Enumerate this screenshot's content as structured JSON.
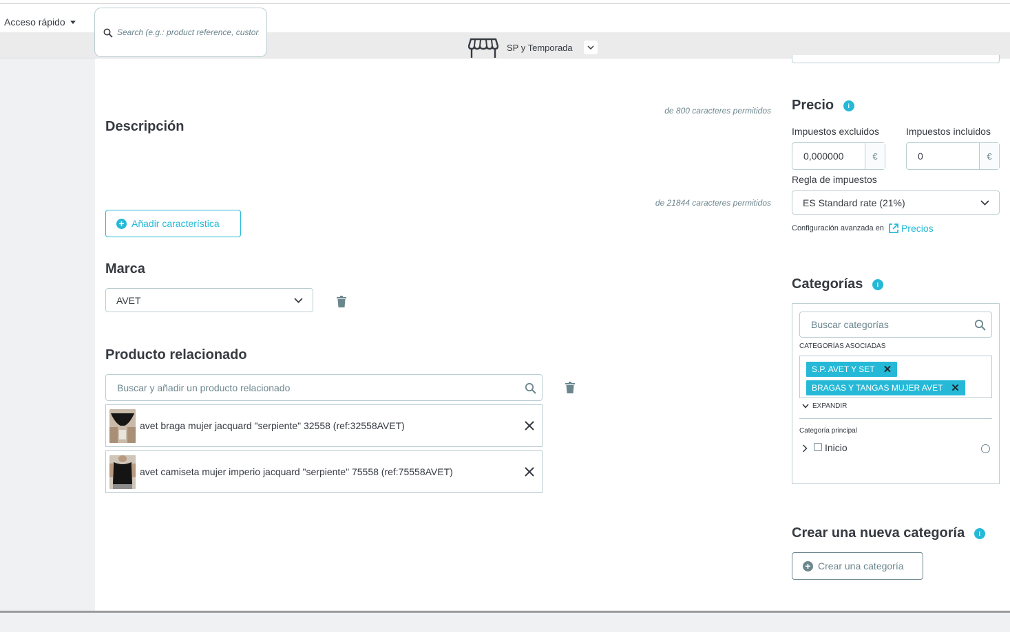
{
  "header": {
    "quick_access": "Acceso rápido",
    "search_placeholder": "Search (e.g.: product reference, custon",
    "shop_name": "SP y Temporada"
  },
  "main": {
    "summary_counter": "de 800 caracteres permitidos",
    "description_title": "Descripción",
    "description_counter": "de 21844 caracteres permitidos",
    "add_feature_button": "Añadir característica",
    "brand_title": "Marca",
    "brand_value": "AVET",
    "related_title": "Producto relacionado",
    "related_search_placeholder": "Buscar y añadir un producto relacionado",
    "related_items": [
      {
        "name": "avet braga mujer jacquard \"serpiente\" 32558 (ref:32558AVET)"
      },
      {
        "name": "avet camiseta mujer imperio jacquard \"serpiente\" 75558 (ref:75558AVET)"
      }
    ]
  },
  "sidebar": {
    "price_title": "Precio",
    "tax_excluded_label": "Impuestos excluidos",
    "tax_included_label": "Impuestos incluidos",
    "tax_excluded_value": "0,000000",
    "tax_included_value": "0",
    "currency": "€",
    "tax_rule_label": "Regla de impuestos",
    "tax_rule_value": "ES Standard rate (21%)",
    "advanced_config_text": "Configuración avanzada en",
    "advanced_config_link": "Precios",
    "categories_title": "Categorías",
    "categories_search_placeholder": "Buscar categorías",
    "associated_label": "CATEGORÍAS ASOCIADAS",
    "associated_tags": [
      "S.P. AVET Y SET",
      "BRAGAS Y TANGAS MUJER AVET"
    ],
    "expand_label": "EXPANDIR",
    "main_category_label": "Categoría principal",
    "tree_root": "Inicio",
    "new_category_title": "Crear una nueva categoría",
    "create_category_button": "Crear una categoría"
  },
  "colors": {
    "accent": "#25b9d7",
    "text": "#363a41",
    "muted": "#6c868e",
    "border": "#bbcdd2"
  }
}
